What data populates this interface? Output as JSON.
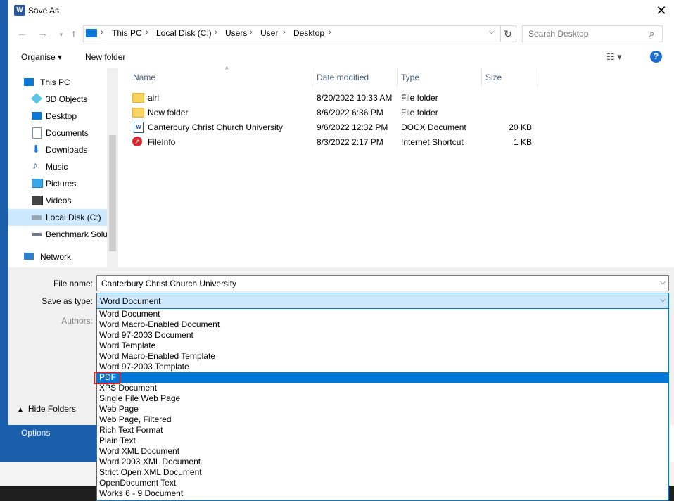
{
  "window": {
    "title": "Save As",
    "close_glyph": "✕"
  },
  "background": {
    "options_label": "Options"
  },
  "address_bar": {
    "crumbs": [
      "This PC",
      "Local Disk (C:)",
      "Users",
      "User",
      "Desktop"
    ]
  },
  "search": {
    "placeholder": "Search Desktop"
  },
  "toolbar": {
    "organise_label": "Organise ▾",
    "new_folder_label": "New folder",
    "view_glyph": "☷ ▾",
    "help_glyph": "?"
  },
  "nav_pane": {
    "items": [
      {
        "label": "This PC",
        "icon": "pc-icon"
      },
      {
        "label": "3D Objects",
        "icon": "cube-icon"
      },
      {
        "label": "Desktop",
        "icon": "desktop-icon"
      },
      {
        "label": "Documents",
        "icon": "documents-icon"
      },
      {
        "label": "Downloads",
        "icon": "download-icon"
      },
      {
        "label": "Music",
        "icon": "music-icon"
      },
      {
        "label": "Pictures",
        "icon": "pictures-icon"
      },
      {
        "label": "Videos",
        "icon": "videos-icon"
      },
      {
        "label": "Local Disk (C:)",
        "icon": "drive-icon",
        "selected": true
      },
      {
        "label": "Benchmark Solu",
        "icon": "drive-icon"
      },
      {
        "label": "Network",
        "icon": "network-icon"
      }
    ]
  },
  "file_list": {
    "columns": [
      "Name",
      "Date modified",
      "Type",
      "Size"
    ],
    "rows": [
      {
        "name": "airi",
        "date": "8/20/2022 10:33 AM",
        "type": "File folder",
        "size": "",
        "icon": "folder-icon"
      },
      {
        "name": "New folder",
        "date": "8/6/2022 6:36 PM",
        "type": "File folder",
        "size": "",
        "icon": "folder-icon"
      },
      {
        "name": "Canterbury Christ Church University",
        "date": "9/6/2022 12:32 PM",
        "type": "DOCX Document",
        "size": "20 KB",
        "icon": "docx-icon"
      },
      {
        "name": "FileInfo",
        "date": "8/3/2022 2:17 PM",
        "type": "Internet Shortcut",
        "size": "1 KB",
        "icon": "url-icon"
      }
    ]
  },
  "form": {
    "file_name_label": "File name:",
    "file_name_value": "Canterbury Christ Church University",
    "save_type_label": "Save as type:",
    "save_type_value": "Word Document",
    "authors_label": "Authors:",
    "hide_folders_label": "Hide Folders"
  },
  "save_type_options": [
    "Word Document",
    "Word Macro-Enabled Document",
    "Word 97-2003 Document",
    "Word Template",
    "Word Macro-Enabled Template",
    "Word 97-2003 Template",
    "PDF",
    "XPS Document",
    "Single File Web Page",
    "Web Page",
    "Web Page, Filtered",
    "Rich Text Format",
    "Plain Text",
    "Word XML Document",
    "Word 2003 XML Document",
    "Strict Open XML Document",
    "OpenDocument Text",
    "Works 6 - 9 Document"
  ],
  "highlighted_option": "PDF",
  "colors": {
    "accent": "#0078d7",
    "highlight_box": "#e21c1c",
    "backstage": "#1b5eab"
  }
}
